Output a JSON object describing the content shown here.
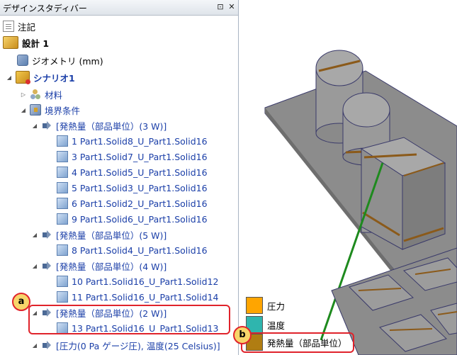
{
  "panel": {
    "title": "デザインスタディバー",
    "pin_glyph": "⊡",
    "close_glyph": "✕"
  },
  "tree": {
    "notes": "注記",
    "design": "設計 1",
    "geometry": "ジオメトリ (mm)",
    "scenario": "シナリオ1",
    "materials": "材料",
    "boundary": "境界条件",
    "group1": {
      "label": "[発熱量（部品単位）(3 W)]",
      "items": [
        "1 Part1.Solid8_U_Part1.Solid16",
        "3 Part1.Solid7_U_Part1.Solid16",
        "4 Part1.Solid5_U_Part1.Solid16",
        "5 Part1.Solid3_U_Part1.Solid16",
        "6 Part1.Solid2_U_Part1.Solid16",
        "9 Part1.Solid6_U_Part1.Solid16"
      ]
    },
    "group2": {
      "label": "[発熱量（部品単位）(5 W)]",
      "items": [
        "8 Part1.Solid4_U_Part1.Solid16"
      ]
    },
    "group3": {
      "label": "[発熱量（部品単位）(4 W)]",
      "items": [
        "10 Part1.Solid16_U_Part1.Solid12",
        "11 Part1.Solid16_U_Part1.Solid14"
      ]
    },
    "group4": {
      "label": "[発熱量（部品単位）(2 W)]",
      "items": [
        "13 Part1.Solid16_U_Part1.Solid13"
      ]
    },
    "group5": {
      "label": "[圧力(0 Pa ゲージ圧), 温度(25 Celsius)]"
    }
  },
  "annotations": {
    "a": "a",
    "b": "b"
  },
  "legend": [
    {
      "label": "圧力",
      "color": "#ffa500"
    },
    {
      "label": "温度",
      "color": "#2fb5ae"
    },
    {
      "label": "発熱量（部品単位）",
      "color": "#b07d12"
    }
  ],
  "colors": {
    "tree_blue": "#1b3fa8",
    "highlight": "#e0232b",
    "badge": "#f7d56a",
    "model_gray": "#8c8c8c",
    "leader_green": "#1e8a1e"
  }
}
